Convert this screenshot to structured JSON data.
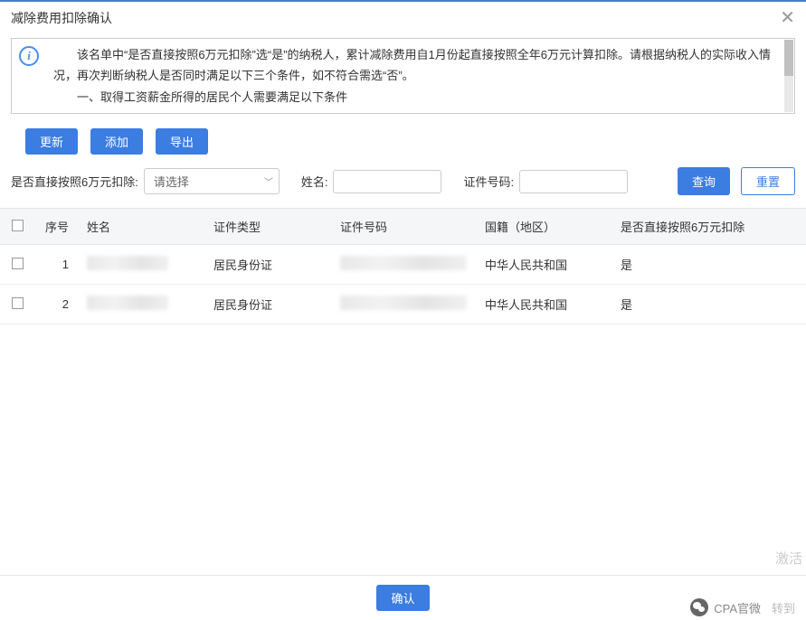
{
  "header": {
    "title": "减除费用扣除确认"
  },
  "notice": {
    "line1": "　　该名单中“是否直接按照6万元扣除”选“是”的纳税人，累计减除费用自1月份起直接按照全年6万元计算扣除。请根据纳税人的实际收入情况，再次判断纳税人是否同时满足以下三个条件，如不符合需选“否”。",
    "line2": "　　一、取得工资薪金所得的居民个人需要满足以下条件"
  },
  "toolbar": {
    "update": "更新",
    "add": "添加",
    "export": "导出"
  },
  "filters": {
    "deduct_label": "是否直接按照6万元扣除:",
    "deduct_placeholder": "请选择",
    "name_label": "姓名:",
    "idnum_label": "证件号码:",
    "query": "查询",
    "reset": "重置"
  },
  "table": {
    "cols": {
      "seq": "序号",
      "name": "姓名",
      "type": "证件类型",
      "idnum": "证件号码",
      "country": "国籍（地区）",
      "deduct": "是否直接按照6万元扣除"
    },
    "rows": [
      {
        "seq": "1",
        "type": "居民身份证",
        "country": "中华人民共和国",
        "deduct": "是"
      },
      {
        "seq": "2",
        "type": "居民身份证",
        "country": "中华人民共和国",
        "deduct": "是"
      }
    ]
  },
  "footer": {
    "confirm": "确认"
  },
  "overlay": {
    "activate": "激活",
    "wechat": "CPA官微",
    "extra": "转到"
  }
}
